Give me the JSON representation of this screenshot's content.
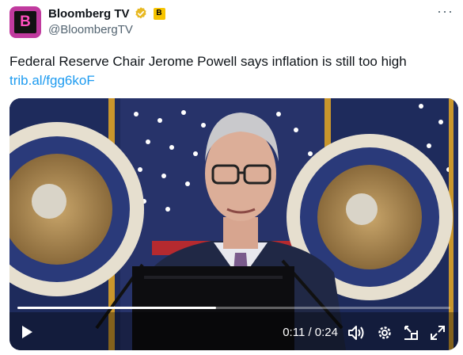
{
  "author": {
    "display_name": "Bloomberg TV",
    "handle": "@BloombergTV",
    "avatar_letter": "B",
    "affiliate_badge": "B"
  },
  "tweet": {
    "text": "Federal Reserve Chair Jerome Powell says inflation is still too high",
    "link": "trib.al/fgg6koF"
  },
  "video": {
    "time_display": "0:11 / 0:24",
    "progress_fraction": 0.458
  },
  "icons": {
    "more": "more-options-icon",
    "verified": "gold-verified-badge-icon",
    "play": "play-icon",
    "volume": "volume-icon",
    "settings": "settings-gear-icon",
    "pip": "picture-in-picture-icon",
    "fullscreen": "fullscreen-icon"
  },
  "colors": {
    "link": "#1d9bf0",
    "avatar_bg": "#c03a9e",
    "verified_gold": "#e8b923"
  }
}
